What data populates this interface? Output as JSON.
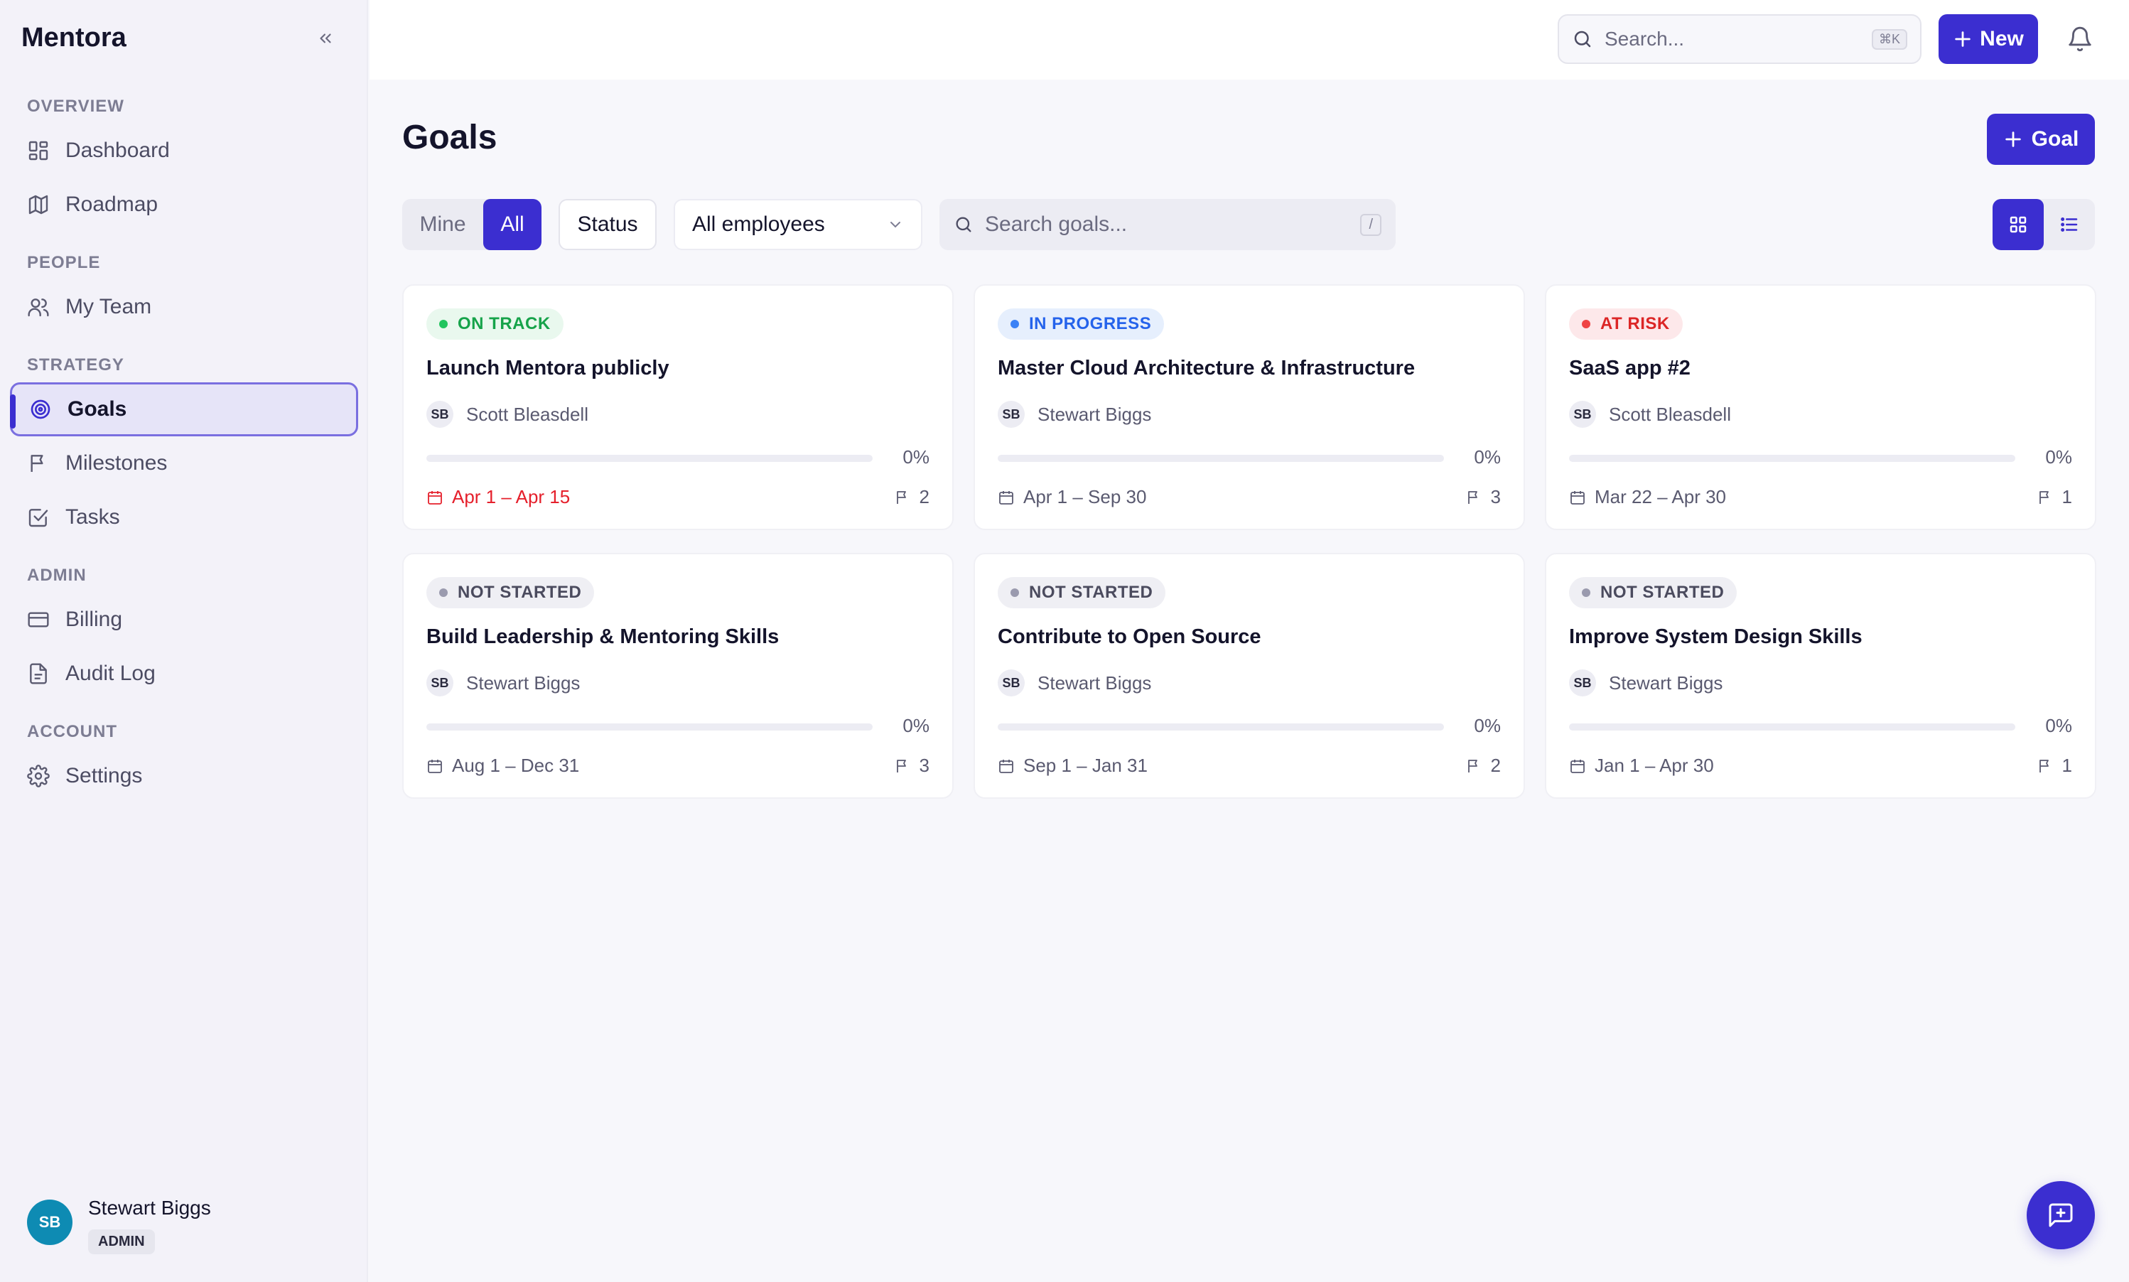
{
  "app": {
    "brand": "Mentora"
  },
  "sidebar": {
    "sections": [
      {
        "label": "OVERVIEW",
        "items": [
          {
            "label": "Dashboard",
            "icon": "dashboard-icon"
          },
          {
            "label": "Roadmap",
            "icon": "map-icon"
          }
        ]
      },
      {
        "label": "PEOPLE",
        "items": [
          {
            "label": "My Team",
            "icon": "users-icon"
          }
        ]
      },
      {
        "label": "STRATEGY",
        "items": [
          {
            "label": "Goals",
            "icon": "target-icon",
            "active": true
          },
          {
            "label": "Milestones",
            "icon": "flag-icon"
          },
          {
            "label": "Tasks",
            "icon": "checkbox-icon"
          }
        ]
      },
      {
        "label": "ADMIN",
        "items": [
          {
            "label": "Billing",
            "icon": "credit-card-icon"
          },
          {
            "label": "Audit Log",
            "icon": "file-text-icon"
          }
        ]
      },
      {
        "label": "ACCOUNT",
        "items": [
          {
            "label": "Settings",
            "icon": "gear-icon"
          }
        ]
      }
    ],
    "user": {
      "initials": "SB",
      "name": "Stewart Biggs",
      "role": "ADMIN"
    }
  },
  "topbar": {
    "search_placeholder": "Search...",
    "search_shortcut": "⌘K",
    "new_label": "New"
  },
  "main": {
    "title": "Goals",
    "add_goal_label": "Goal",
    "filters": {
      "scope_options": [
        "Mine",
        "All"
      ],
      "scope_selected": "All",
      "status_label": "Status",
      "employee_selected": "All employees",
      "search_placeholder": "Search goals...",
      "search_shortcut": "/"
    },
    "view_mode": "grid"
  },
  "goals": [
    {
      "status": "ON TRACK",
      "title": "Launch Mentora publicly",
      "owner_initials": "SB",
      "owner": "Scott Bleasdell",
      "progress": 0,
      "progress_label": "0%",
      "dates": "Apr 1 – Apr 15",
      "overdue": true,
      "milestones": "2"
    },
    {
      "status": "IN PROGRESS",
      "title": "Master Cloud Architecture & Infrastructure",
      "owner_initials": "SB",
      "owner": "Stewart Biggs",
      "progress": 0,
      "progress_label": "0%",
      "dates": "Apr 1 – Sep 30",
      "overdue": false,
      "milestones": "3"
    },
    {
      "status": "AT RISK",
      "title": "SaaS app #2",
      "owner_initials": "SB",
      "owner": "Scott Bleasdell",
      "progress": 0,
      "progress_label": "0%",
      "dates": "Mar 22 – Apr 30",
      "overdue": false,
      "milestones": "1"
    },
    {
      "status": "NOT STARTED",
      "title": "Build Leadership & Mentoring Skills",
      "owner_initials": "SB",
      "owner": "Stewart Biggs",
      "progress": 0,
      "progress_label": "0%",
      "dates": "Aug 1 – Dec 31",
      "overdue": false,
      "milestones": "3"
    },
    {
      "status": "NOT STARTED",
      "title": "Contribute to Open Source",
      "owner_initials": "SB",
      "owner": "Stewart Biggs",
      "progress": 0,
      "progress_label": "0%",
      "dates": "Sep 1 – Jan 31",
      "overdue": false,
      "milestones": "2"
    },
    {
      "status": "NOT STARTED",
      "title": "Improve System Design Skills",
      "owner_initials": "SB",
      "owner": "Stewart Biggs",
      "progress": 0,
      "progress_label": "0%",
      "dates": "Jan 1 – Apr 30",
      "overdue": false,
      "milestones": "1"
    }
  ],
  "status_colors": {
    "ON TRACK": {
      "bg": "#e9f8ee",
      "fg": "#16a34a",
      "dot": "#22c55e"
    },
    "IN PROGRESS": {
      "bg": "#e6effd",
      "fg": "#2563eb",
      "dot": "#3b82f6"
    },
    "AT RISK": {
      "bg": "#fde8ea",
      "fg": "#dc2626",
      "dot": "#ef4444"
    },
    "NOT STARTED": {
      "bg": "#efeff4",
      "fg": "#4b4b5e",
      "dot": "#9a9aae"
    }
  },
  "colors": {
    "accent": "#3b2ed0",
    "overdue": "#e5202c"
  }
}
